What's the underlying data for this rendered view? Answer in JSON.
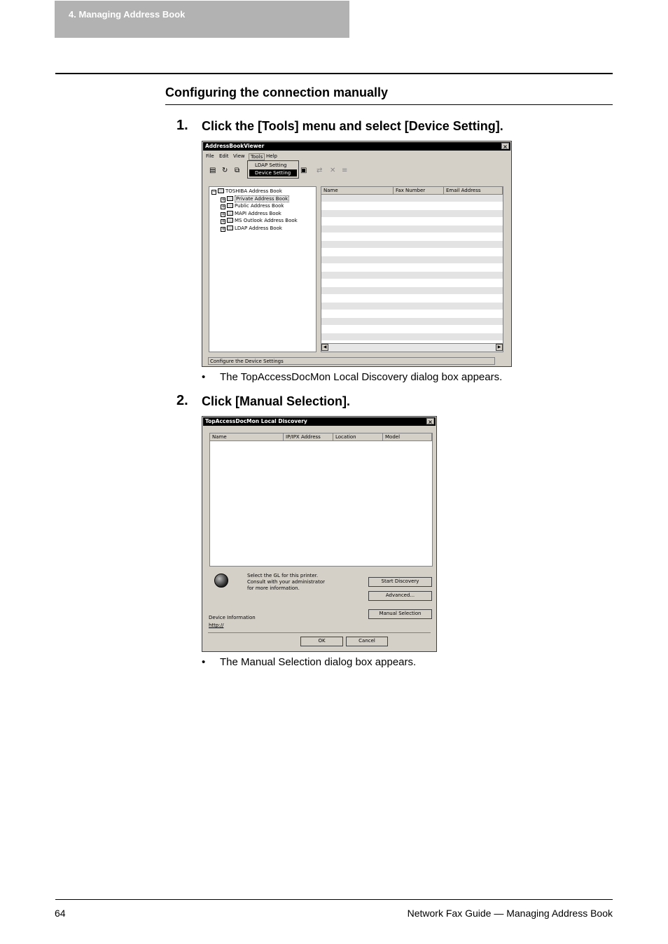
{
  "header": {
    "chapter": "4. Managing Address Book"
  },
  "section": {
    "title": "Configuring the connection manually"
  },
  "steps": [
    {
      "number": "1.",
      "text": "Click the [Tools] menu and select [Device Setting].",
      "bullet": "The TopAccessDocMon Local Discovery dialog box appears."
    },
    {
      "number": "2.",
      "text": "Click [Manual Selection].",
      "bullet": "The Manual Selection dialog box appears."
    }
  ],
  "bullet_char": "•",
  "screenshot1": {
    "title": "AddressBookViewer",
    "close": "×",
    "menu": [
      "File",
      "Edit",
      "View",
      "Tools",
      "Help"
    ],
    "tools_menu": [
      "LDAP Setting",
      "Device Setting"
    ],
    "tree": {
      "root": "TOSHIBA Address Book",
      "items": [
        "Private Address Book",
        "Public Address Book",
        "MAPI Address Book",
        "MS Outlook Address Book",
        "LDAP Address Book"
      ]
    },
    "columns": [
      "Name",
      "Fax Number",
      "Email Address"
    ],
    "status": "Configure the Device Settings",
    "icons": [
      "address-book-icon",
      "refresh-icon",
      "copy-icon",
      "properties-icon",
      "sync-icon",
      "delete-icon",
      "list-icon"
    ]
  },
  "screenshot2": {
    "title": "TopAccessDocMon Local Discovery",
    "close": "×",
    "columns": [
      "Name",
      "IP/IPX Address",
      "Location",
      "Model"
    ],
    "info_text": "Select the GL for this printer. Consult with your administrator for more information.",
    "buttons": {
      "start": "Start Discovery",
      "advanced": "Advanced...",
      "manual": "Manual Selection",
      "ok": "OK",
      "cancel": "Cancel"
    },
    "device_info_label": "Device Information",
    "device_info_value": "http://",
    "icons": [
      "globe-icon"
    ]
  },
  "footer": {
    "page": "64",
    "title": "Network Fax Guide — Managing Address Book"
  }
}
